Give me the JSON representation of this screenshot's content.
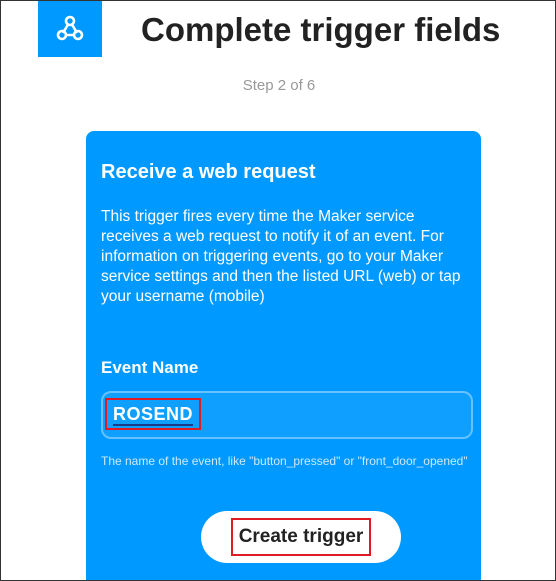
{
  "header": {
    "logo_icon": "webhooks-icon",
    "title": "Complete trigger fields",
    "step": "Step 2 of 6"
  },
  "card": {
    "title": "Receive a web request",
    "description": "This trigger fires every time the Maker service receives a web request to notify it of an event. For information on triggering events, go to your Maker service settings and then the listed URL (web) or tap your username (mobile)",
    "field_label": "Event Name",
    "field_value": "ROSEND",
    "field_help": "The name of the event, like \"button_pressed\" or \"front_door_opened\"",
    "submit_label": "Create trigger"
  },
  "colors": {
    "brand_blue": "#0099ff",
    "highlight_red": "#e01b24"
  }
}
